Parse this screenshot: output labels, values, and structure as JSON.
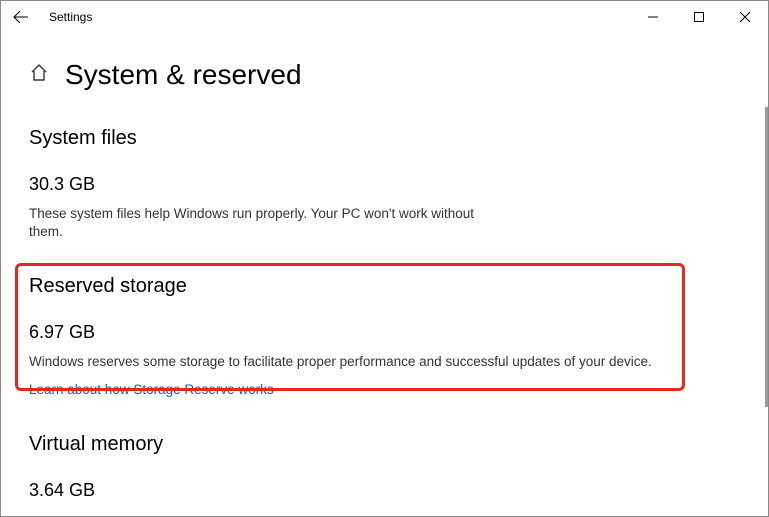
{
  "window": {
    "title": "Settings"
  },
  "page": {
    "title": "System & reserved"
  },
  "sections": {
    "system_files": {
      "title": "System files",
      "size": "30.3 GB",
      "desc": "These system files help Windows run properly. Your PC won't work without them."
    },
    "reserved": {
      "title": "Reserved storage",
      "size": "6.97 GB",
      "desc": "Windows reserves some storage to facilitate proper performance and successful updates of your device.",
      "link": "Learn about how Storage Reserve works"
    },
    "virtual_memory": {
      "title": "Virtual memory",
      "size": "3.64 GB"
    }
  }
}
